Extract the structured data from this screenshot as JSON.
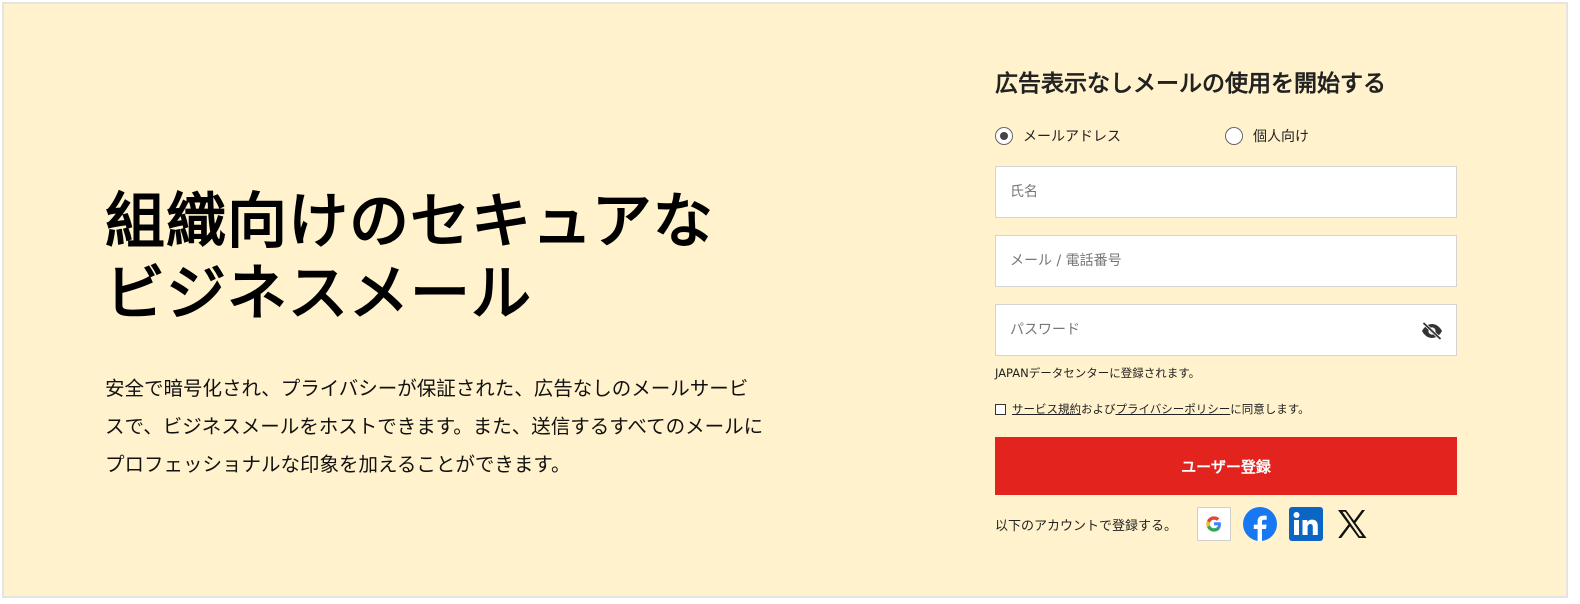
{
  "hero": {
    "title_lines": [
      "組織向けのセキュアな",
      "ビジネスメール"
    ],
    "description_lines": [
      "安全で暗号化され、プライバシーが保証された、広告なしのメールサービ",
      "スで、ビジネスメールをホストできます。また、送信するすべてのメールに",
      "プロフェッショナルな印象を加えることができます。"
    ]
  },
  "form": {
    "title": "広告表示なしメールの使用を開始する",
    "radio_options": [
      {
        "label": "メールアドレス",
        "selected": true
      },
      {
        "label": "個人向け",
        "selected": false
      }
    ],
    "name_placeholder": "氏名",
    "email_placeholder": "メール / 電話番号",
    "password_placeholder": "パスワード",
    "datacenter_note": "JAPANデータセンターに登録されます。",
    "consent": {
      "terms_link": "サービス規約",
      "and_text": "および",
      "privacy_link": "プライバシーポリシー",
      "suffix": "に同意します。"
    },
    "submit_label": "ユーザー登録",
    "social_label": "以下のアカウントで登録する。",
    "social_icons": [
      "google-icon",
      "facebook-icon",
      "linkedin-icon",
      "x-icon"
    ]
  },
  "colors": {
    "background": "#fff2cc",
    "submit": "#e2231e",
    "facebook": "#1877f2",
    "linkedin": "#0a66c2"
  }
}
